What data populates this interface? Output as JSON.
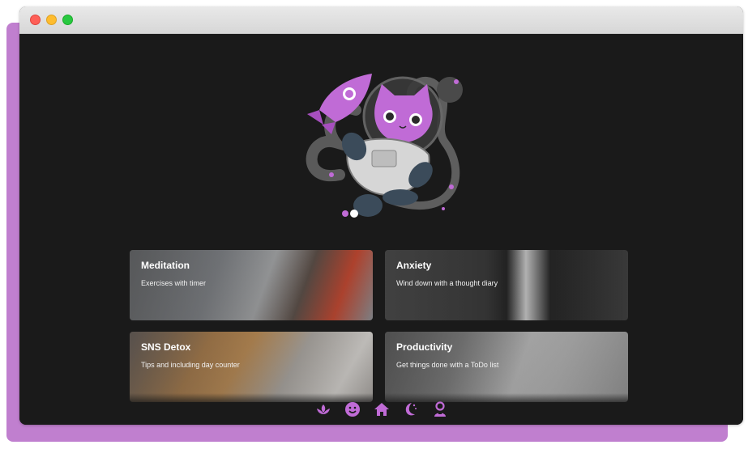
{
  "window": {
    "controls": [
      "close",
      "minimize",
      "maximize"
    ]
  },
  "hero": {
    "illustration": "astronaut-cat-with-rocket",
    "accent_color": "#c06bd6"
  },
  "cards": [
    {
      "id": "meditation",
      "title": "Meditation",
      "subtitle": "Exercises with timer"
    },
    {
      "id": "anxiety",
      "title": "Anxiety",
      "subtitle": "Wind down with a thought diary"
    },
    {
      "id": "sns",
      "title": "SNS Detox",
      "subtitle": "Tips and including day counter"
    },
    {
      "id": "productivity",
      "title": "Productivity",
      "subtitle": "Get things done with a ToDo list"
    }
  ],
  "bottom_nav": {
    "icon_color": "#c06bd6",
    "items": [
      "lotus-icon",
      "smiley-icon",
      "home-icon",
      "moon-icon",
      "profile-icon"
    ]
  },
  "colors": {
    "background": "#1a1a1a",
    "frame_accent": "#c07fcf",
    "card_text": "#ffffff"
  }
}
